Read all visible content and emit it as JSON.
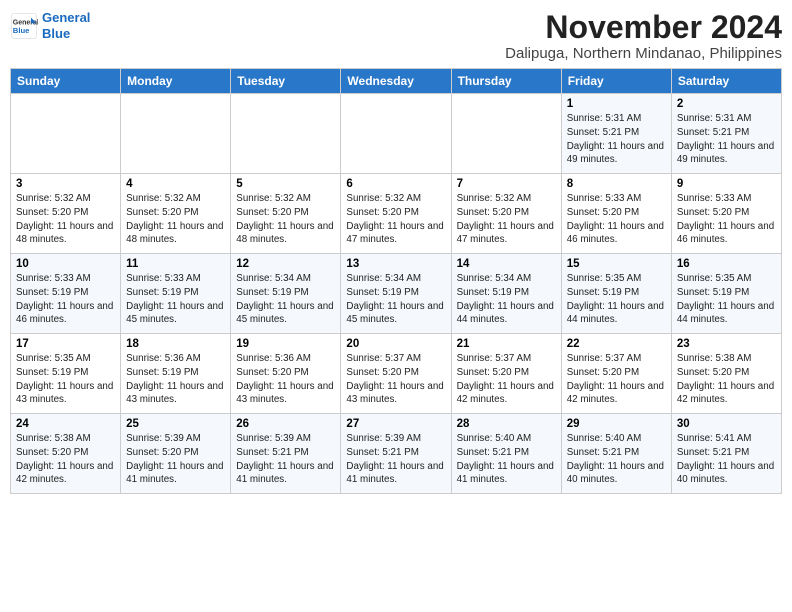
{
  "header": {
    "logo_line1": "General",
    "logo_line2": "Blue",
    "title": "November 2024",
    "subtitle": "Dalipuga, Northern Mindanao, Philippines"
  },
  "days_of_week": [
    "Sunday",
    "Monday",
    "Tuesday",
    "Wednesday",
    "Thursday",
    "Friday",
    "Saturday"
  ],
  "weeks": [
    [
      {
        "day": "",
        "info": ""
      },
      {
        "day": "",
        "info": ""
      },
      {
        "day": "",
        "info": ""
      },
      {
        "day": "",
        "info": ""
      },
      {
        "day": "",
        "info": ""
      },
      {
        "day": "1",
        "info": "Sunrise: 5:31 AM\nSunset: 5:21 PM\nDaylight: 11 hours and 49 minutes."
      },
      {
        "day": "2",
        "info": "Sunrise: 5:31 AM\nSunset: 5:21 PM\nDaylight: 11 hours and 49 minutes."
      }
    ],
    [
      {
        "day": "3",
        "info": "Sunrise: 5:32 AM\nSunset: 5:20 PM\nDaylight: 11 hours and 48 minutes."
      },
      {
        "day": "4",
        "info": "Sunrise: 5:32 AM\nSunset: 5:20 PM\nDaylight: 11 hours and 48 minutes."
      },
      {
        "day": "5",
        "info": "Sunrise: 5:32 AM\nSunset: 5:20 PM\nDaylight: 11 hours and 48 minutes."
      },
      {
        "day": "6",
        "info": "Sunrise: 5:32 AM\nSunset: 5:20 PM\nDaylight: 11 hours and 47 minutes."
      },
      {
        "day": "7",
        "info": "Sunrise: 5:32 AM\nSunset: 5:20 PM\nDaylight: 11 hours and 47 minutes."
      },
      {
        "day": "8",
        "info": "Sunrise: 5:33 AM\nSunset: 5:20 PM\nDaylight: 11 hours and 46 minutes."
      },
      {
        "day": "9",
        "info": "Sunrise: 5:33 AM\nSunset: 5:20 PM\nDaylight: 11 hours and 46 minutes."
      }
    ],
    [
      {
        "day": "10",
        "info": "Sunrise: 5:33 AM\nSunset: 5:19 PM\nDaylight: 11 hours and 46 minutes."
      },
      {
        "day": "11",
        "info": "Sunrise: 5:33 AM\nSunset: 5:19 PM\nDaylight: 11 hours and 45 minutes."
      },
      {
        "day": "12",
        "info": "Sunrise: 5:34 AM\nSunset: 5:19 PM\nDaylight: 11 hours and 45 minutes."
      },
      {
        "day": "13",
        "info": "Sunrise: 5:34 AM\nSunset: 5:19 PM\nDaylight: 11 hours and 45 minutes."
      },
      {
        "day": "14",
        "info": "Sunrise: 5:34 AM\nSunset: 5:19 PM\nDaylight: 11 hours and 44 minutes."
      },
      {
        "day": "15",
        "info": "Sunrise: 5:35 AM\nSunset: 5:19 PM\nDaylight: 11 hours and 44 minutes."
      },
      {
        "day": "16",
        "info": "Sunrise: 5:35 AM\nSunset: 5:19 PM\nDaylight: 11 hours and 44 minutes."
      }
    ],
    [
      {
        "day": "17",
        "info": "Sunrise: 5:35 AM\nSunset: 5:19 PM\nDaylight: 11 hours and 43 minutes."
      },
      {
        "day": "18",
        "info": "Sunrise: 5:36 AM\nSunset: 5:19 PM\nDaylight: 11 hours and 43 minutes."
      },
      {
        "day": "19",
        "info": "Sunrise: 5:36 AM\nSunset: 5:20 PM\nDaylight: 11 hours and 43 minutes."
      },
      {
        "day": "20",
        "info": "Sunrise: 5:37 AM\nSunset: 5:20 PM\nDaylight: 11 hours and 43 minutes."
      },
      {
        "day": "21",
        "info": "Sunrise: 5:37 AM\nSunset: 5:20 PM\nDaylight: 11 hours and 42 minutes."
      },
      {
        "day": "22",
        "info": "Sunrise: 5:37 AM\nSunset: 5:20 PM\nDaylight: 11 hours and 42 minutes."
      },
      {
        "day": "23",
        "info": "Sunrise: 5:38 AM\nSunset: 5:20 PM\nDaylight: 11 hours and 42 minutes."
      }
    ],
    [
      {
        "day": "24",
        "info": "Sunrise: 5:38 AM\nSunset: 5:20 PM\nDaylight: 11 hours and 42 minutes."
      },
      {
        "day": "25",
        "info": "Sunrise: 5:39 AM\nSunset: 5:20 PM\nDaylight: 11 hours and 41 minutes."
      },
      {
        "day": "26",
        "info": "Sunrise: 5:39 AM\nSunset: 5:21 PM\nDaylight: 11 hours and 41 minutes."
      },
      {
        "day": "27",
        "info": "Sunrise: 5:39 AM\nSunset: 5:21 PM\nDaylight: 11 hours and 41 minutes."
      },
      {
        "day": "28",
        "info": "Sunrise: 5:40 AM\nSunset: 5:21 PM\nDaylight: 11 hours and 41 minutes."
      },
      {
        "day": "29",
        "info": "Sunrise: 5:40 AM\nSunset: 5:21 PM\nDaylight: 11 hours and 40 minutes."
      },
      {
        "day": "30",
        "info": "Sunrise: 5:41 AM\nSunset: 5:21 PM\nDaylight: 11 hours and 40 minutes."
      }
    ]
  ]
}
